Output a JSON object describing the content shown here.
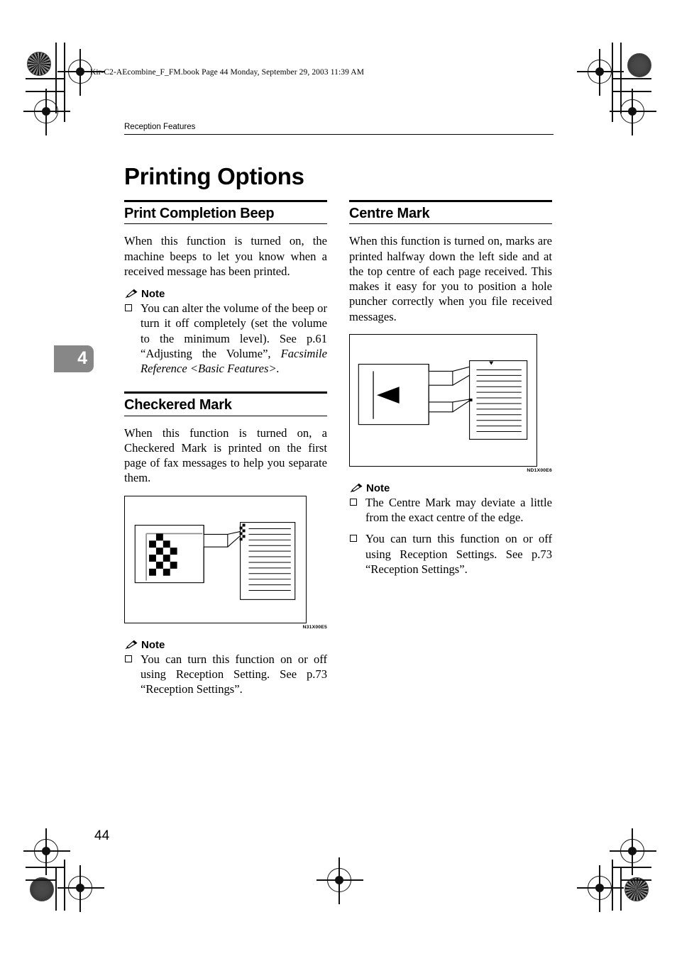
{
  "book_header": "Kir-C2-AEcombine_F_FM.book  Page 44  Monday, September 29, 2003  11:39 AM",
  "running_head": "Reception Features",
  "page_title": "Printing Options",
  "chapter_tab": "4",
  "page_number": "44",
  "note_label": "Note",
  "left_column": {
    "section1": {
      "heading": "Print Completion Beep",
      "body": "When this function is turned on, the machine beeps to let you know when a received message has been printed.",
      "notes": [
        {
          "text": "You can alter the volume of the beep or turn it off completely (set the volume to the minimum level). See p.61 “Adjusting the Volume”, ",
          "italic_tail": "Facsimile Reference <Basic Features>."
        }
      ]
    },
    "section2": {
      "heading": "Checkered Mark",
      "body": "When this function is turned on, a Checkered Mark is printed on the first page of fax messages to help you separate them.",
      "figure_code": "N31X00E5",
      "notes": [
        {
          "text": "You can turn this function on or off using Reception Setting. See p.73 “Reception Settings”."
        }
      ]
    }
  },
  "right_column": {
    "section1": {
      "heading": "Centre Mark",
      "body": "When this function is turned on, marks are printed halfway down the left side and at the top centre of each page received. This makes it easy for you to position a hole puncher correctly when you file received messages.",
      "figure_code": "ND1X00E6",
      "notes": [
        {
          "text": "The Centre Mark may deviate a little from the exact centre of the edge."
        },
        {
          "text": "You can turn this function on or off using Reception Settings. See p.73 “Reception Settings”."
        }
      ]
    }
  },
  "colors": {
    "ink": "#000000",
    "chapter_tab_bg": "#878787",
    "chapter_tab_text": "#ffffff"
  }
}
